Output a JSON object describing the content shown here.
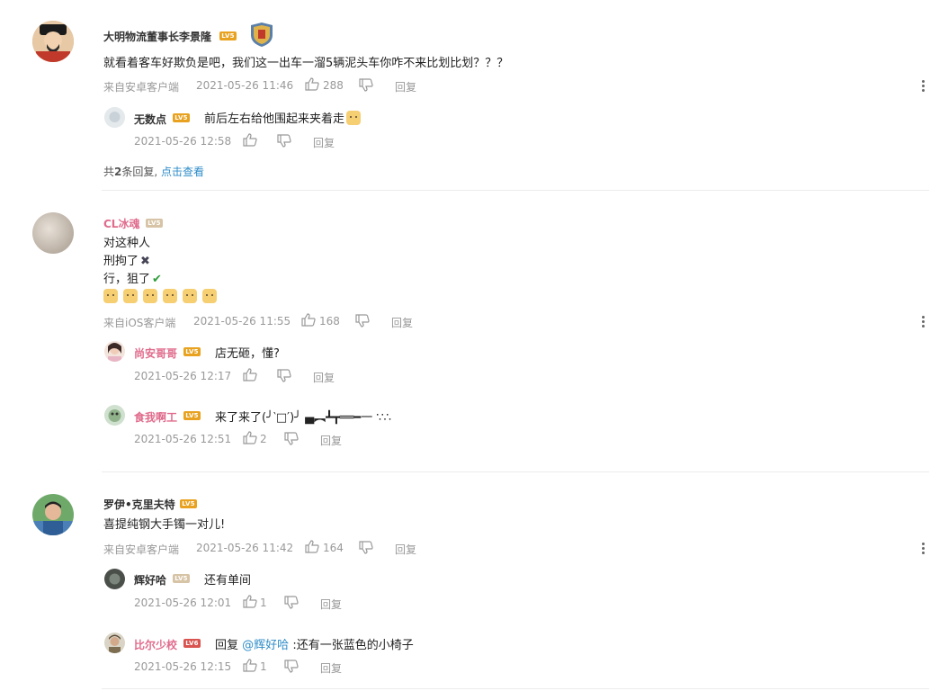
{
  "comments": [
    {
      "user": "大明物流董事长李景隆",
      "level": "LV5",
      "text": "就看着客车好欺负是吧，我们这一出车一溜5辆泥头车你咋不来比划比划？？？",
      "source": "来自安卓客户端",
      "time": "2021-05-26 11:46",
      "likes": "288",
      "reply_label": "回复",
      "replies": [
        {
          "user": "无数点",
          "level": "LV5",
          "text": "前后左右给他围起来夹着走",
          "time": "2021-05-26 12:58",
          "likes": "",
          "reply_label": "回复"
        }
      ],
      "total_prefix": "共",
      "total_count": "2",
      "total_suffix": "条回复,",
      "view_more": "点击查看"
    },
    {
      "user": "CL冰魂",
      "level": "LV5",
      "lines": [
        "对这种人",
        "刑拘了",
        "行，狙了"
      ],
      "source": "来自iOS客户端",
      "time": "2021-05-26 11:55",
      "likes": "168",
      "reply_label": "回复",
      "replies": [
        {
          "user": "尚安哥哥",
          "level": "LV5",
          "text": "店无砸，懂?",
          "time": "2021-05-26 12:17",
          "likes": "",
          "reply_label": "回复"
        },
        {
          "user": "食我啊工",
          "level": "LV5",
          "text": "来了来了(╯‵□′)╯ ▄︻┻┳══━一 ∵∴",
          "time": "2021-05-26 12:51",
          "likes": "2",
          "reply_label": "回复"
        }
      ]
    },
    {
      "user": "罗伊•克里夫特",
      "level": "LV5",
      "text": "喜提纯钢大手镯一对儿!",
      "source": "来自安卓客户端",
      "time": "2021-05-26 11:42",
      "likes": "164",
      "reply_label": "回复",
      "replies": [
        {
          "user": "辉好哈",
          "level": "LV5",
          "text": "还有单间",
          "time": "2021-05-26 12:01",
          "likes": "1",
          "reply_label": "回复"
        },
        {
          "user": "比尔少校",
          "level": "LV6",
          "reply_prefix": "回复",
          "mention": "@辉好哈",
          "text": ":还有一张蓝色的小椅子",
          "time": "2021-05-26 12:15",
          "likes": "1",
          "reply_label": "回复"
        }
      ]
    }
  ],
  "colors": {
    "accent_link": "#2e8cc8",
    "pink_name": "#e06b8c",
    "level_gold": "#e9a21f",
    "meta_gray": "#999999"
  }
}
